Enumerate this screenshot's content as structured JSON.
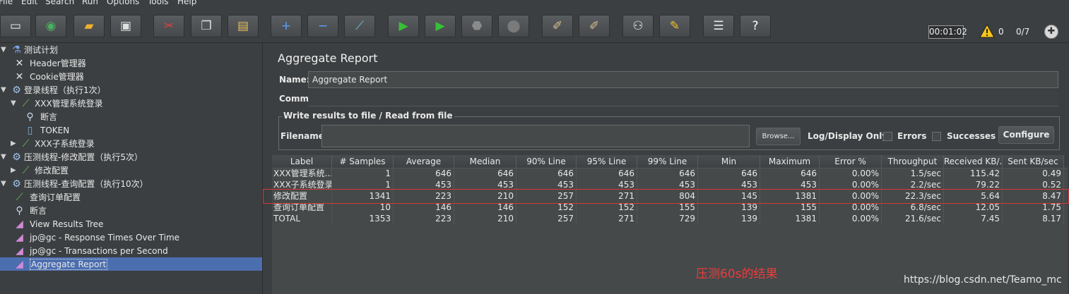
{
  "menu": [
    "File",
    "Edit",
    "Search",
    "Run",
    "Options",
    "Tools",
    "Help"
  ],
  "toolbar": {
    "buttons": [
      {
        "name": "new-icon",
        "glyph": "▭",
        "color": "#f0f0f0"
      },
      {
        "name": "templates-icon",
        "glyph": "◉",
        "color": "#4ab060"
      },
      {
        "name": "open-icon",
        "glyph": "▰",
        "color": "#f0b030"
      },
      {
        "name": "save-icon",
        "glyph": "▣",
        "color": "#e0e0e0"
      },
      {
        "name": "cut-icon",
        "glyph": "✂",
        "color": "#e04040"
      },
      {
        "name": "copy-icon",
        "glyph": "❐",
        "color": "#e0e0e0"
      },
      {
        "name": "paste-icon",
        "glyph": "▤",
        "color": "#e8c060"
      },
      {
        "name": "expand-icon",
        "glyph": "+",
        "color": "#5aa0ff"
      },
      {
        "name": "collapse-icon",
        "glyph": "−",
        "color": "#5aa0ff"
      },
      {
        "name": "toggle-icon",
        "glyph": "⟋",
        "color": "#70c0e0"
      },
      {
        "name": "start-icon",
        "glyph": "▶",
        "color": "#36c236"
      },
      {
        "name": "start-no-pauses-icon",
        "glyph": "▶",
        "color": "#36c236"
      },
      {
        "name": "stop-icon",
        "glyph": "⬣",
        "color": "#8a8a8a"
      },
      {
        "name": "shutdown-icon",
        "glyph": "⬤",
        "color": "#7a7a7a"
      },
      {
        "name": "clear-icon",
        "glyph": "✐",
        "color": "#d8c090"
      },
      {
        "name": "clear-all-icon",
        "glyph": "✐",
        "color": "#d8c090"
      },
      {
        "name": "search-icon",
        "glyph": "⚇",
        "color": "#e8e8e8"
      },
      {
        "name": "reset-search-icon",
        "glyph": "✎",
        "color": "#f0c030"
      },
      {
        "name": "function-helper-icon",
        "glyph": "☰",
        "color": "#e8e8e8"
      },
      {
        "name": "help-icon",
        "glyph": "?",
        "color": "#ffffff"
      }
    ],
    "timer": "00:01:02",
    "warning_count": "0",
    "threads": "0/7"
  },
  "tree": [
    {
      "label": "测试计划",
      "toggle": "▼",
      "icon": "flask-icon",
      "glyph": "⚗",
      "level": 0
    },
    {
      "label": "Header管理器",
      "toggle": "",
      "icon": "wrench-icon",
      "glyph": "✕",
      "level": 1
    },
    {
      "label": "Cookie管理器",
      "toggle": "",
      "icon": "wrench-icon",
      "glyph": "✕",
      "level": 1
    },
    {
      "label": "登录线程（执行1次）",
      "toggle": "▼",
      "icon": "gear-icon",
      "glyph": "⚙",
      "level": 0
    },
    {
      "label": "XXX管理系统登录",
      "toggle": "▼",
      "icon": "pipette-icon",
      "glyph": "⟋",
      "level": 1
    },
    {
      "label": "断言",
      "toggle": "",
      "icon": "magnifier-icon",
      "glyph": "⚲",
      "level": 2
    },
    {
      "label": "TOKEN",
      "toggle": "",
      "icon": "document-icon",
      "glyph": "▯",
      "level": 2
    },
    {
      "label": "XXX子系统登录",
      "toggle": "▶",
      "icon": "pipette-icon",
      "glyph": "⟋",
      "level": 1
    },
    {
      "label": "压测线程-修改配置（执行5次）",
      "toggle": "▼",
      "icon": "gear-icon",
      "glyph": "⚙",
      "level": 0
    },
    {
      "label": "修改配置",
      "toggle": "▶",
      "icon": "pipette-icon",
      "glyph": "⟋",
      "level": 1
    },
    {
      "label": "压测线程-查询配置（执行10次）",
      "toggle": "▼",
      "icon": "gear-icon",
      "glyph": "⚙",
      "level": 0
    },
    {
      "label": "查询订单配置",
      "toggle": "",
      "icon": "pipette-icon",
      "glyph": "⟋",
      "level": 1
    },
    {
      "label": "断言",
      "toggle": "",
      "icon": "magnifier-icon",
      "glyph": "⚲",
      "level": 1
    },
    {
      "label": "View Results Tree",
      "toggle": "",
      "icon": "graph-icon",
      "glyph": "◢",
      "level": 1
    },
    {
      "label": "jp@gc - Response Times Over Time",
      "toggle": "",
      "icon": "graph-icon",
      "glyph": "◢",
      "level": 1
    },
    {
      "label": "jp@gc - Transactions per Second",
      "toggle": "",
      "icon": "graph-icon",
      "glyph": "◢",
      "level": 1
    },
    {
      "label": "Aggregate Report",
      "toggle": "",
      "icon": "graph-icon",
      "glyph": "◢",
      "level": 1,
      "selected": true
    }
  ],
  "panel": {
    "title": "Aggregate Report",
    "name_label": "Name:",
    "name_value": "Aggregate Report",
    "comments_label": "Comments:",
    "fieldset_legend": "Write results to file / Read from file",
    "filename_label": "Filename",
    "browse_label": "Browse...",
    "log_display_label": "Log/Display Only:",
    "errors_label": "Errors",
    "successes_label": "Successes",
    "configure_label": "Configure"
  },
  "table": {
    "columns": [
      "Label",
      "# Samples",
      "Average",
      "Median",
      "90% Line",
      "95% Line",
      "99% Line",
      "Min",
      "Maximum",
      "Error %",
      "Throughput",
      "Received KB/...",
      "Sent KB/sec"
    ],
    "rows": [
      [
        "XXX管理系统...",
        "1",
        "646",
        "646",
        "646",
        "646",
        "646",
        "646",
        "646",
        "0.00%",
        "1.5/sec",
        "115.42",
        "0.49"
      ],
      [
        "XXX子系统登录",
        "1",
        "453",
        "453",
        "453",
        "453",
        "453",
        "453",
        "453",
        "0.00%",
        "2.2/sec",
        "79.22",
        "0.52"
      ],
      [
        "修改配置",
        "1341",
        "223",
        "210",
        "257",
        "271",
        "804",
        "145",
        "1381",
        "0.00%",
        "22.3/sec",
        "5.64",
        "8.47"
      ],
      [
        "查询订单配置",
        "10",
        "146",
        "146",
        "152",
        "152",
        "155",
        "139",
        "155",
        "0.00%",
        "6.8/sec",
        "12.05",
        "1.75"
      ],
      [
        "TOTAL",
        "1353",
        "223",
        "210",
        "257",
        "271",
        "729",
        "139",
        "1381",
        "0.00%",
        "21.6/sec",
        "7.45",
        "8.17"
      ]
    ]
  },
  "annotation": "压测60s的结果",
  "watermark": "https://blog.csdn.net/Teamo_mc",
  "colors": {
    "highlight": "#d33a3a",
    "annotation": "#ef3b3b",
    "selection": "#4b6eaf"
  }
}
